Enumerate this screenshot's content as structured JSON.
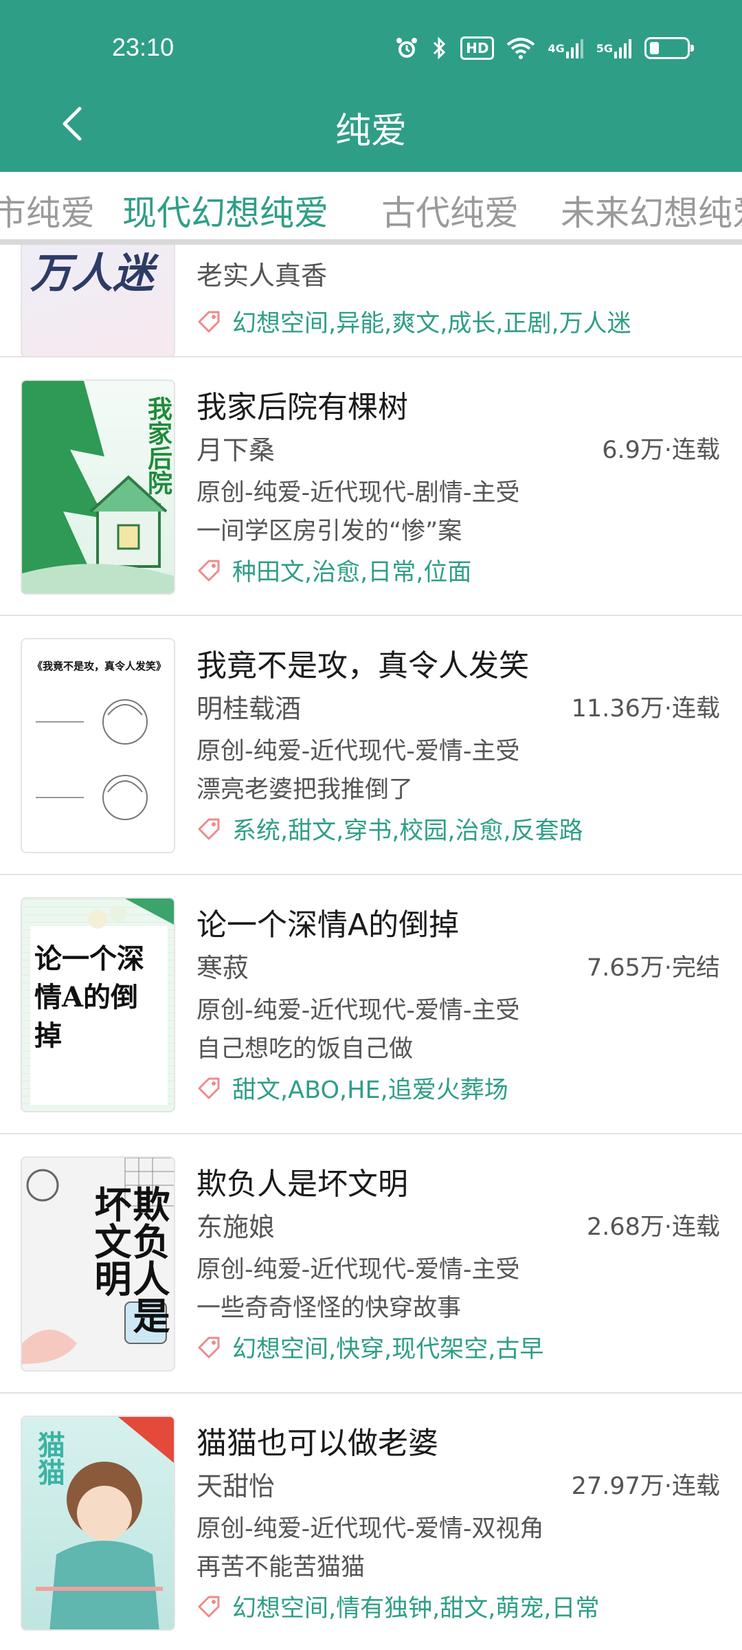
{
  "status_bar": {
    "time": "23:10",
    "hd_label": "HD",
    "net_4g": "4G",
    "net_5g": "5G",
    "battery_level": 0.25
  },
  "header": {
    "title": "纯爱"
  },
  "tabs": [
    {
      "label": "都市纯爱",
      "active": false
    },
    {
      "label": "现代幻想纯爱",
      "active": true
    },
    {
      "label": "古代纯爱",
      "active": false
    },
    {
      "label": "未来幻想纯爱",
      "active": false
    }
  ],
  "colors": {
    "accent": "#2f9e87",
    "tag_icon": "#f08a8a"
  },
  "books": [
    {
      "title": "",
      "author": "老实人真香",
      "stats": "",
      "category": "",
      "description": "",
      "tags": "幻想空间,异能,爽文,成长,正剧,万人迷",
      "cover_text": "万人迷"
    },
    {
      "title": "我家后院有棵树",
      "author": "月下桑",
      "stats": "6.9万·连载",
      "category": "原创-纯爱-近代现代-剧情-主受",
      "description": "一间学区房引发的“惨”案",
      "tags": "种田文,治愈,日常,位面",
      "cover_text": "我家后院"
    },
    {
      "title": "我竟不是攻，真令人发笑",
      "author": "明桂载酒",
      "stats": "11.36万·连载",
      "category": "原创-纯爱-近代现代-爱情-主受",
      "description": "漂亮老婆把我推倒了",
      "tags": "系统,甜文,穿书,校园,治愈,反套路",
      "cover_text": "《我竟不是攻，真令人发笑》"
    },
    {
      "title": "论一个深情A的倒掉",
      "author": "寒菽",
      "stats": "7.65万·完结",
      "category": "原创-纯爱-近代现代-爱情-主受",
      "description": "自己想吃的饭自己做",
      "tags": "甜文,ABO,HE,追爱火葬场",
      "cover_text": "论一个深情A的倒掉"
    },
    {
      "title": "欺负人是坏文明",
      "author": "东施娘",
      "stats": "2.68万·连载",
      "category": "原创-纯爱-近代现代-爱情-主受",
      "description": "一些奇奇怪怪的快穿故事",
      "tags": "幻想空间,快穿,现代架空,古早",
      "cover_text": "欺负人是坏文明"
    },
    {
      "title": "猫猫也可以做老婆",
      "author": "天甜怡",
      "stats": "27.97万·连载",
      "category": "原创-纯爱-近代现代-爱情-双视角",
      "description": "再苦不能苦猫猫",
      "tags": "幻想空间,情有独钟,甜文,萌宠,日常",
      "cover_text": "猫猫"
    }
  ]
}
